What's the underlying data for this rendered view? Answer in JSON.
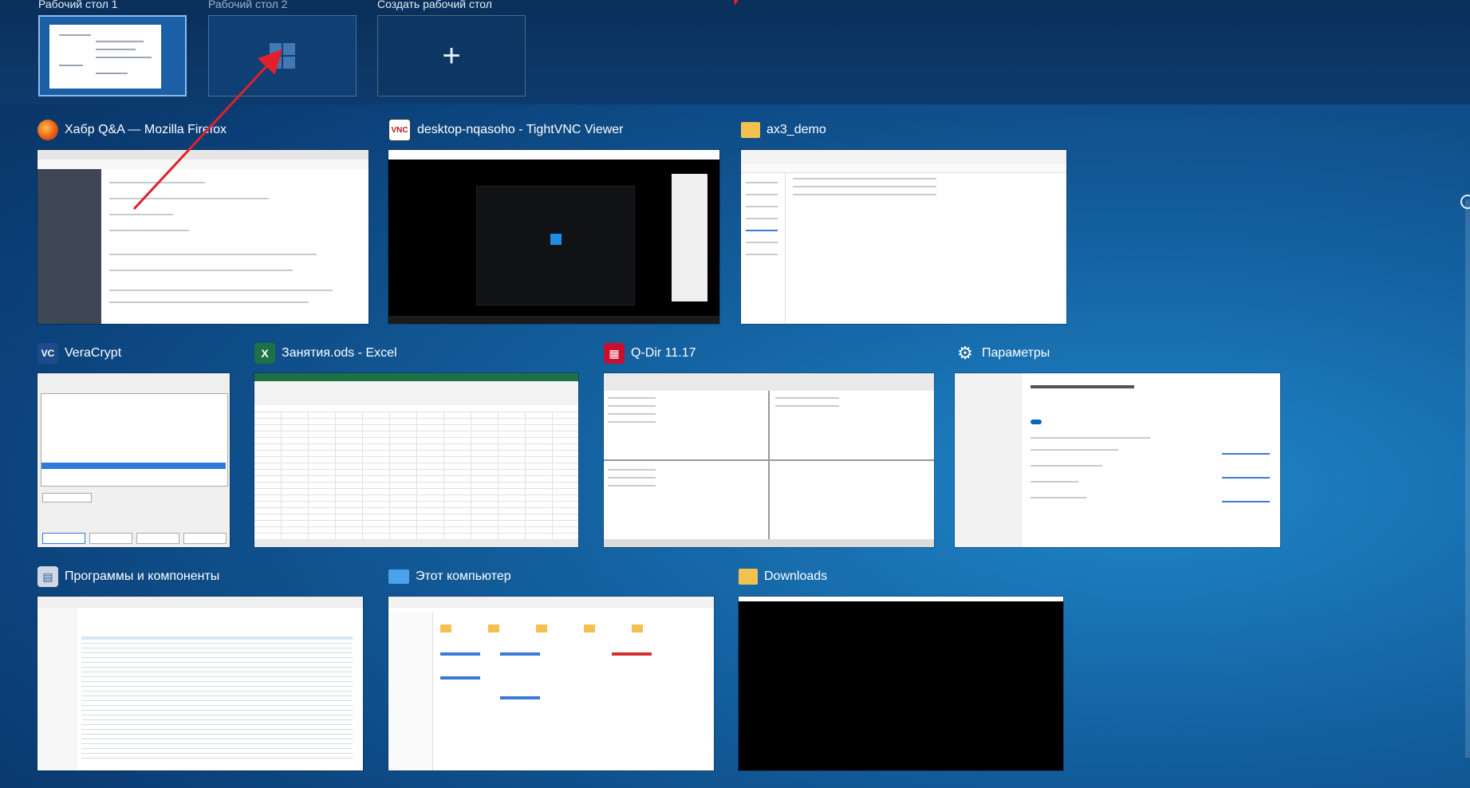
{
  "desktops": [
    {
      "label": "Рабочий стол 1",
      "active": true
    },
    {
      "label": "Рабочий стол 2",
      "active": false
    },
    {
      "label": "Создать рабочий стол",
      "active": false
    }
  ],
  "windows": [
    {
      "title": "Хабр Q&A — Mozilla Firefox",
      "icon": "firefox-icon"
    },
    {
      "title": "desktop-nqasoho - TightVNC Viewer",
      "icon": "vnc-icon"
    },
    {
      "title": "ax3_demo",
      "icon": "folder-icon"
    },
    {
      "title": "VeraCrypt",
      "icon": "veracrypt-icon"
    },
    {
      "title": "Занятия.ods - Excel",
      "icon": "excel-icon"
    },
    {
      "title": "Q-Dir 11.17",
      "icon": "qdir-icon"
    },
    {
      "title": "Параметры",
      "icon": "gear-icon"
    },
    {
      "title": "Программы и компоненты",
      "icon": "programs-icon"
    },
    {
      "title": "Этот компьютер",
      "icon": "computer-icon"
    },
    {
      "title": "Downloads",
      "icon": "folder-icon"
    }
  ],
  "colors": {
    "accent_arrow": "#e0202a",
    "excel_green": "#1e7145",
    "folder_yellow": "#f2c14e"
  }
}
